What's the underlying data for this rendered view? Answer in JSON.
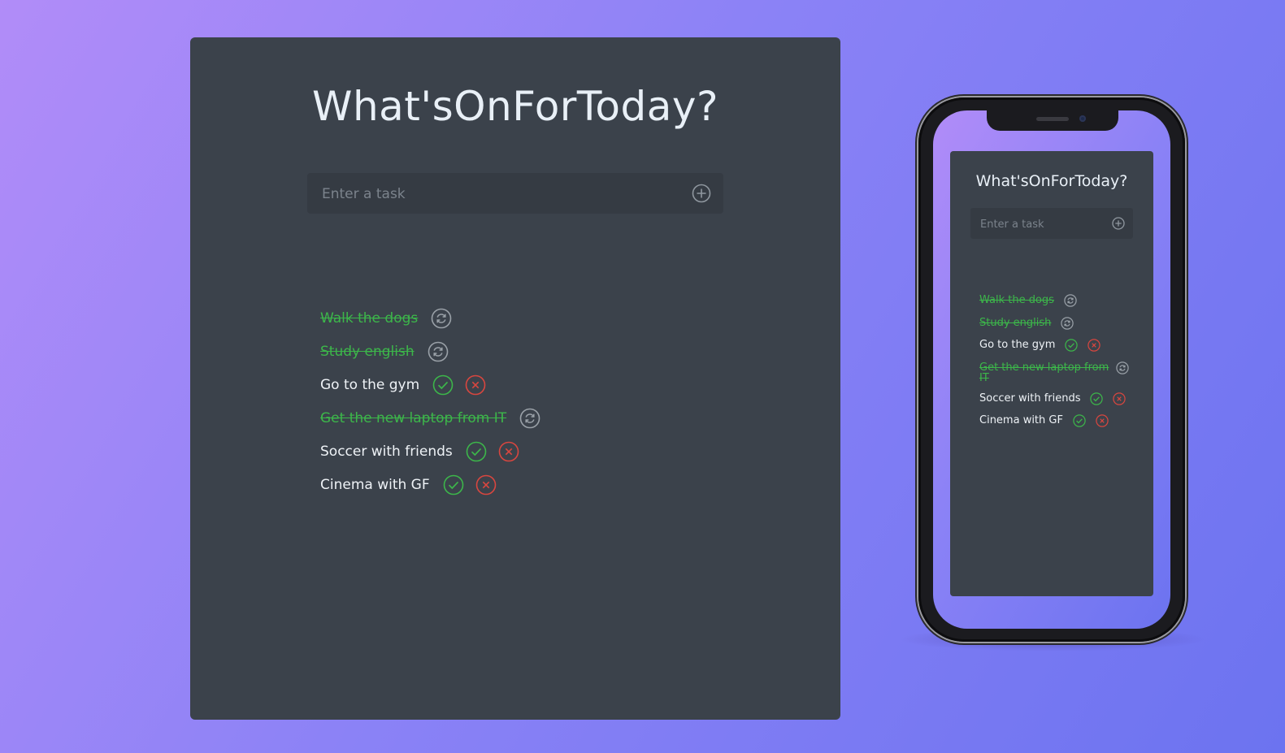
{
  "app": {
    "title": "What'sOnForToday?",
    "input_placeholder": "Enter a task",
    "add_icon": "plus-circle-icon"
  },
  "tasks": [
    {
      "text": "Walk the dogs",
      "done": true
    },
    {
      "text": "Study english",
      "done": true
    },
    {
      "text": "Go to the gym",
      "done": false
    },
    {
      "text": "Get the new laptop from IT",
      "done": true
    },
    {
      "text": "Soccer with friends",
      "done": false
    },
    {
      "text": "Cinema with GF",
      "done": false
    }
  ],
  "icons": {
    "complete": "check-circle-icon",
    "delete": "x-circle-icon",
    "undo": "refresh-circle-icon"
  },
  "colors": {
    "background_start": "#b18cf8",
    "background_end": "#6c73f0",
    "card": "#3b424b",
    "input": "#353b43",
    "title": "#e9f0f7",
    "done_text": "#3cb64a",
    "check": "#3cb64a",
    "delete": "#d9463f",
    "undo": "#9aa1a8"
  }
}
